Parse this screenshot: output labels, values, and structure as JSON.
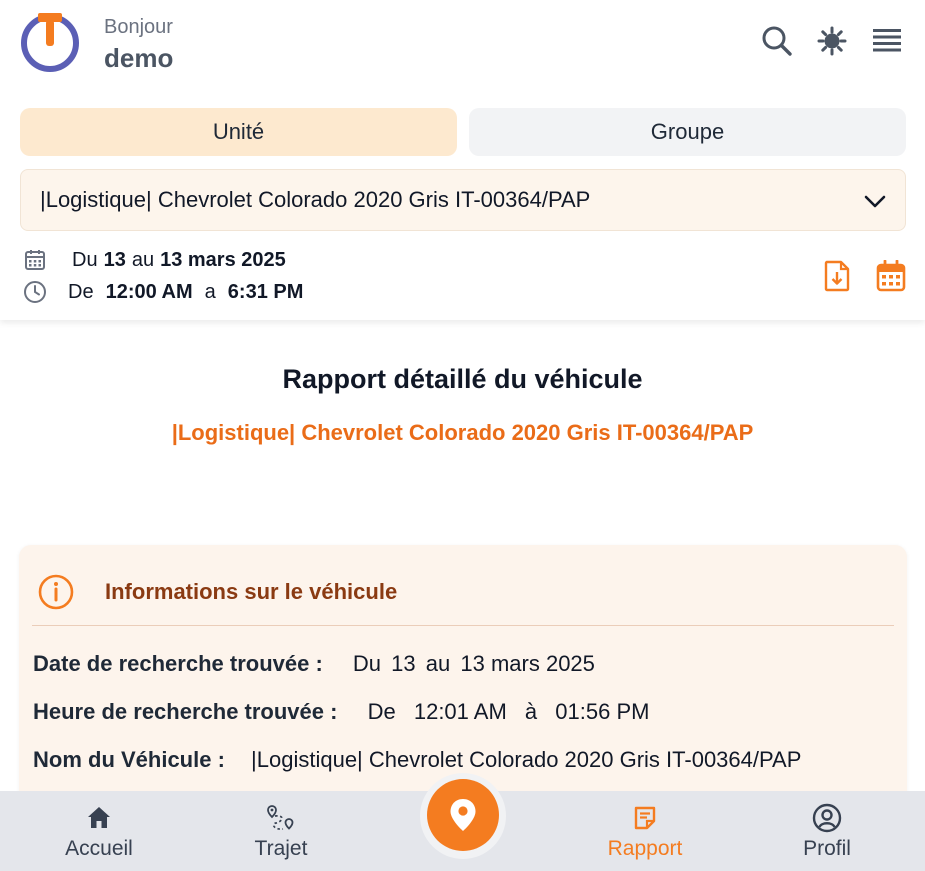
{
  "header": {
    "greeting": "Bonjour",
    "username": "demo",
    "icons": [
      "search-icon",
      "brightness-icon",
      "menu-icon"
    ]
  },
  "tabs": [
    {
      "label": "Unité",
      "active": true
    },
    {
      "label": "Groupe",
      "active": false
    }
  ],
  "vehicle_select": {
    "value": "|Logistique| Chevrolet Colorado 2020 Gris IT-00364/PAP"
  },
  "date_range": {
    "prefix": "Du",
    "start_day": "13",
    "connector": "au",
    "end_date": "13 mars 2025"
  },
  "time_range": {
    "prefix": "De",
    "start": "12:00 AM",
    "connector": "a",
    "end": "6:31 PM"
  },
  "actions": [
    "download-icon",
    "calendar-icon"
  ],
  "report": {
    "title": "Rapport détaillé du véhicule",
    "vehicle": "|Logistique| Chevrolet Colorado 2020 Gris IT-00364/PAP"
  },
  "info_card": {
    "title": "Informations sur le véhicule",
    "rows": [
      {
        "label": "Date de recherche trouvée :",
        "p1": "Du",
        "b1": "13",
        "p2": "au",
        "b2": "13 mars 2025"
      },
      {
        "label": "Heure de recherche trouvée :",
        "p1": "De",
        "b1": "12:01 AM",
        "p2": "à",
        "b2": "01:56 PM"
      },
      {
        "label": "Nom du Véhicule :",
        "value": "|Logistique| Chevrolet Colorado 2020 Gris IT-00364/PAP"
      }
    ]
  },
  "nav": {
    "items": [
      {
        "label": "Accueil",
        "icon": "home-icon"
      },
      {
        "label": "Trajet",
        "icon": "route-icon"
      },
      {
        "label": "Rapport",
        "icon": "report-icon",
        "active": true
      },
      {
        "label": "Profil",
        "icon": "profile-icon"
      }
    ],
    "center_icon": "location-pin-icon"
  },
  "colors": {
    "accent": "#f47c20",
    "report_subtitle": "#ea6c18",
    "card_title": "#8a3a12",
    "tab_active_bg": "#fde9cf",
    "logo_blue": "#5b5fb5"
  }
}
